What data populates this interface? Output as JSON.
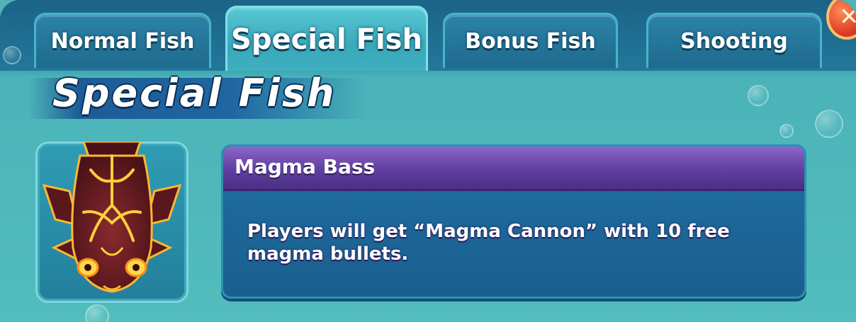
{
  "tabs": [
    {
      "id": "normal",
      "label": "Normal Fish",
      "active": false
    },
    {
      "id": "special",
      "label": "Special Fish",
      "active": true
    },
    {
      "id": "bonus",
      "label": "Bonus Fish",
      "active": false
    },
    {
      "id": "shooting",
      "label": "Shooting",
      "active": false
    }
  ],
  "close_icon": "close-icon",
  "section": {
    "title": "Special Fish"
  },
  "fish": {
    "name": "Magma Bass",
    "description": "Players will get “Magma Cannon” with 10 free magma bullets.",
    "portrait_icon": "magma-bass-icon"
  },
  "colors": {
    "background": "#52bdbd",
    "header_purple": "#5f3f9f",
    "panel_blue": "#1f6fa2",
    "fish_body": "#6e1f24",
    "fish_glow": "#ffcf3a"
  }
}
